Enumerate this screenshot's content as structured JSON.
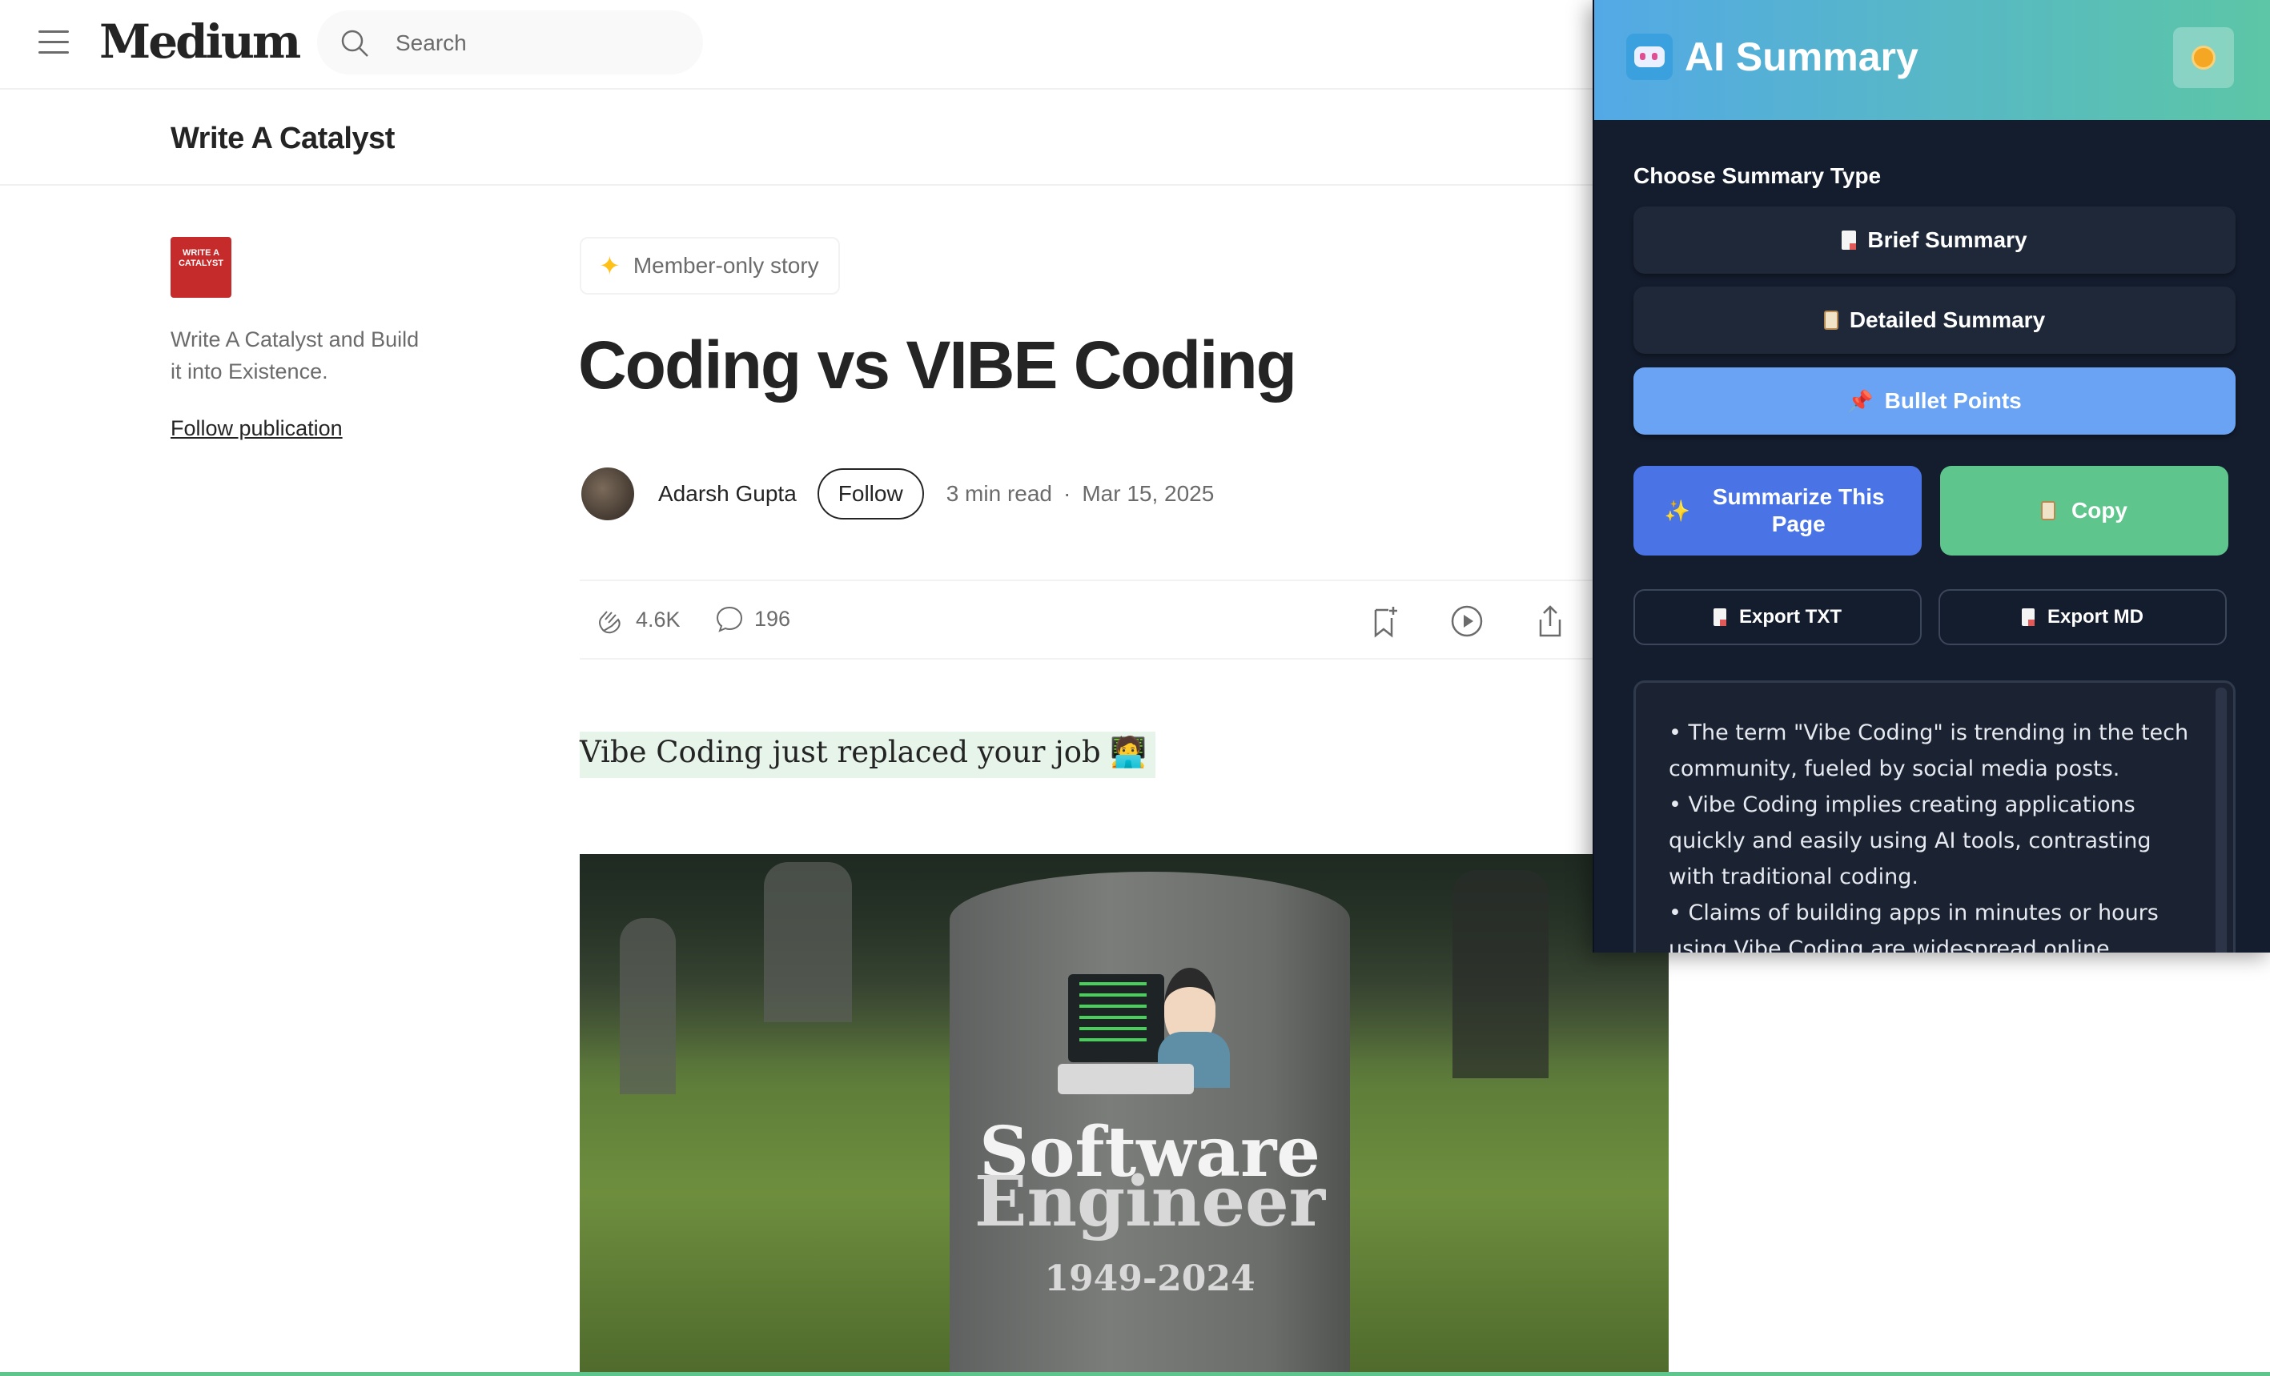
{
  "header": {
    "logo": "Medium",
    "search_placeholder": "Search"
  },
  "publication": {
    "name": "Write A Catalyst",
    "logo_text": "WRITE A CATALYST",
    "description": "Write A Catalyst and Build it into Existence.",
    "follow_link": "Follow publication"
  },
  "article": {
    "badge": "Member-only story",
    "title": "Coding vs VIBE Coding",
    "author": "Adarsh Gupta",
    "follow_label": "Follow",
    "read_time": "3 min read",
    "separator": "·",
    "date": "Mar 15, 2025",
    "claps": "4.6K",
    "comments": "196",
    "subtitle": "Vibe Coding just replaced your job 🧑‍💻",
    "hero": {
      "line1": "Software",
      "line2": "Engineer",
      "years": "1949-2024"
    }
  },
  "panel": {
    "title": "AI Summary",
    "choose_label": "Choose Summary Type",
    "types": [
      {
        "label": "Brief Summary",
        "icon": "document-icon",
        "active": false
      },
      {
        "label": "Detailed Summary",
        "icon": "clipboard-icon",
        "active": false
      },
      {
        "label": "Bullet Points",
        "icon": "pushpin-icon",
        "active": true
      }
    ],
    "summarize_label": "Summarize This Page",
    "copy_label": "Copy",
    "export_txt": "Export TXT",
    "export_md": "Export MD",
    "output_lines": [
      "• The term \"Vibe Coding\" is trending in the tech community, fueled by social media posts.",
      "• Vibe Coding implies creating applications quickly and easily using AI tools, contrasting with traditional coding.",
      "• Claims of building apps in minutes or hours using Vibe Coding are widespread online."
    ],
    "colors": {
      "header_gradient_start": "#53a9e6",
      "header_gradient_end": "#5cc6a6",
      "active_type": "#6aa3f3",
      "summarize": "#4a74e6",
      "copy": "#5ec68c",
      "background": "#141d2e"
    }
  }
}
